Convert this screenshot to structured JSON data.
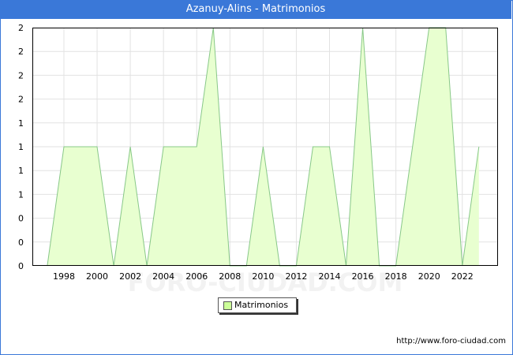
{
  "title": "Azanuy-Alins - Matrimonios",
  "source_url": "http://www.foro-ciudad.com",
  "watermark": "FORO-CIUDAD.COM",
  "colors": {
    "title_bg": "#3a78d8",
    "fill": "#e8ffd0",
    "line": "#88c888",
    "legend_swatch": "#ccff99"
  },
  "chart_data": {
    "type": "area",
    "title": "Azanuy-Alins - Matrimonios",
    "xlabel": "",
    "ylabel": "",
    "x": [
      1997,
      1998,
      1999,
      2000,
      2001,
      2002,
      2003,
      2004,
      2005,
      2006,
      2007,
      2008,
      2009,
      2010,
      2011,
      2012,
      2013,
      2014,
      2015,
      2016,
      2017,
      2018,
      2019,
      2020,
      2021,
      2022,
      2023
    ],
    "series": [
      {
        "name": "Matrimonios",
        "values": [
          0,
          1,
          1,
          1,
          0,
          1,
          0,
          1,
          1,
          1,
          2,
          0,
          0,
          1,
          0,
          0,
          1,
          1,
          0,
          2,
          0,
          0,
          1,
          2,
          2,
          0,
          1
        ]
      }
    ],
    "xticks": [
      "1998",
      "2000",
      "2002",
      "2004",
      "2006",
      "2008",
      "2010",
      "2012",
      "2014",
      "2016",
      "2018",
      "2020",
      "2022"
    ],
    "yticks": [
      "0",
      "0",
      "0",
      "1",
      "1",
      "1",
      "1",
      "2",
      "2",
      "2",
      "2"
    ],
    "ylim": [
      0,
      2
    ],
    "grid": true,
    "legend_position": "bottom-center"
  }
}
